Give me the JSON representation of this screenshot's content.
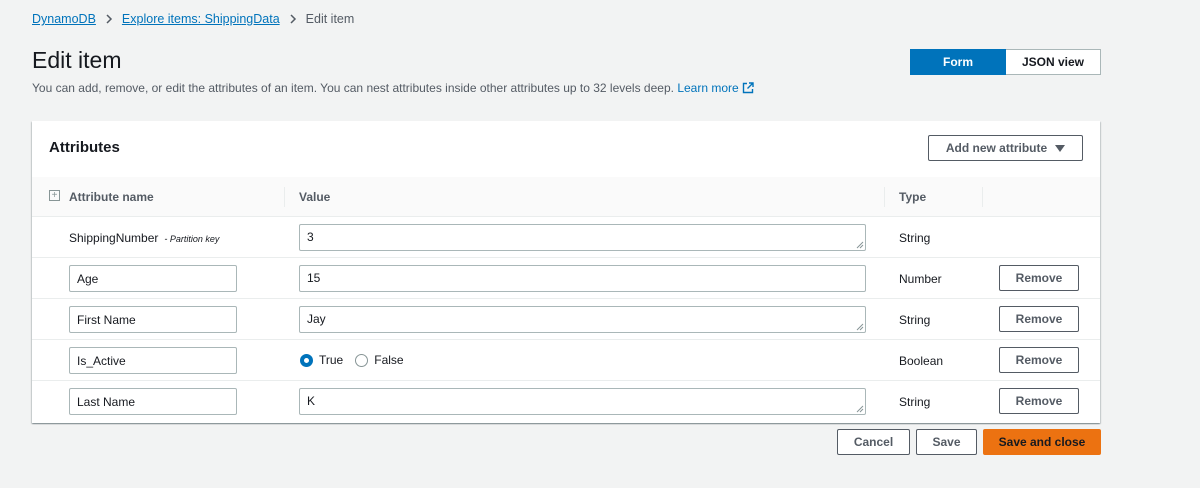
{
  "breadcrumb": {
    "items": [
      "DynamoDB",
      "Explore items: ShippingData"
    ],
    "current": "Edit item"
  },
  "header": {
    "title": "Edit item",
    "description": "You can add, remove, or edit the attributes of an item. You can nest attributes inside other attributes up to 32 levels deep.",
    "learn_more": "Learn more"
  },
  "view_toggle": {
    "form": "Form",
    "json": "JSON view",
    "selected": "Form"
  },
  "attributes": {
    "title": "Attributes",
    "add_button": "Add new attribute",
    "columns": {
      "name": "Attribute name",
      "value": "Value",
      "type": "Type"
    },
    "rows": [
      {
        "name": "ShippingNumber",
        "key_label": "- Partition key",
        "value": "3",
        "type": "String"
      },
      {
        "name": "Age",
        "value": "15",
        "type": "Number",
        "remove": "Remove"
      },
      {
        "name": "First Name",
        "value": "Jay",
        "type": "String",
        "remove": "Remove"
      },
      {
        "name": "Is_Active",
        "options": [
          "True",
          "False"
        ],
        "selected": "True",
        "type": "Boolean",
        "remove": "Remove"
      },
      {
        "name": "Last Name",
        "value": "K",
        "type": "String",
        "remove": "Remove"
      }
    ]
  },
  "footer": {
    "cancel": "Cancel",
    "save": "Save",
    "save_close": "Save and close"
  },
  "colors": {
    "link": "#0073bb",
    "primary": "#ec7211",
    "selected_toggle": "#0073bb",
    "background": "#f2f3f3"
  }
}
